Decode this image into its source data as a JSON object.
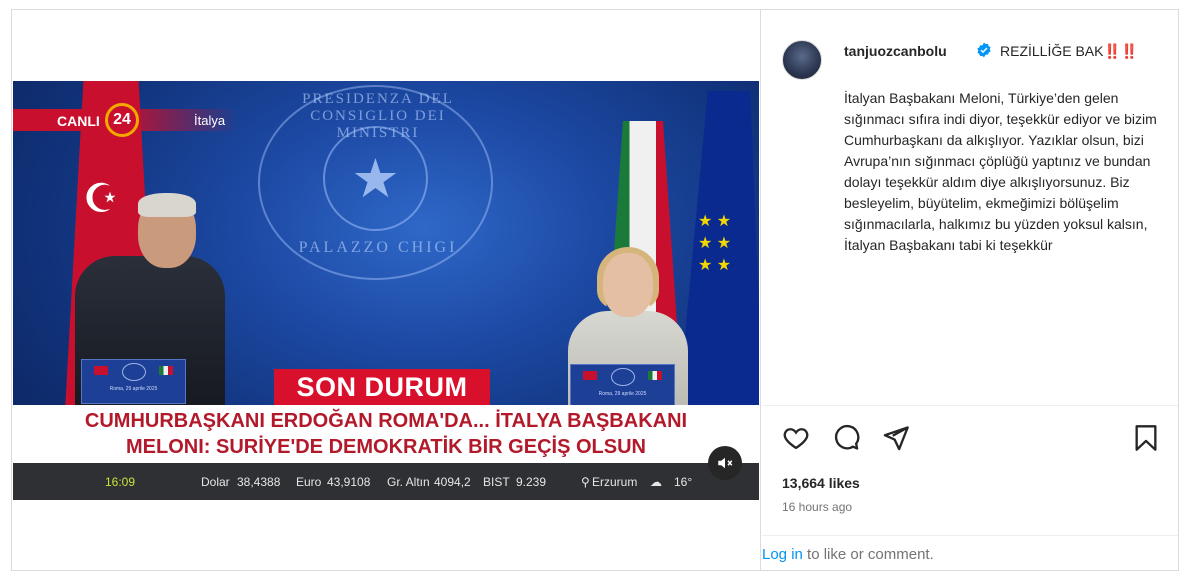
{
  "post": {
    "username": "tanjuozcanbolu",
    "caption_first_line": "REZİLLİĞE BAK‼️‼️",
    "caption_body": "İtalyan Başbakanı Meloni, Türkiye’den gelen sığınmacı sıfıra indi diyor, teşekkür ediyor ve bizim Cumhurbaşkanı da alkışlıyor. Yazıklar olsun, bizi Avrupa’nın sığınmacı çöplüğü yaptınız ve bundan dolayı teşekkür aldım diye alkışlıyorsunuz. Biz besleyelim, büyütelim, ekmeğimizi bölüşelim sığınmacılarla, halkımız bu yüzden yoksul kalsın, İtalyan Başbakanı tabi ki teşekkür",
    "likes": "13,664 likes",
    "time_ago": "16 hours ago",
    "login_link": "Log in",
    "login_suffix": " to like or comment."
  },
  "video": {
    "live_label": "CANLI",
    "channel_number": "24",
    "location_label": "İtalya",
    "seal_top": "PRESIDENZA DEL CONSIGLIO DEI MINISTRI",
    "seal_bottom": "PALAZZO CHIGI",
    "podium_caption": "Roma, 29 aprile 2025",
    "breaking_label": "SON DURUM",
    "headline_line1": "CUMHURBAŞKANI ERDOĞAN ROMA'DA... İTALYA BAŞBAKANI",
    "headline_line2": "MELONI: SURİYE'DE DEMOKRATİK BİR GEÇİŞ OLSUN",
    "ticker": {
      "time": "16:09",
      "dolar_label": "Dolar",
      "dolar_value": "38,4388",
      "euro_label": "Euro",
      "euro_value": "43,9108",
      "gold_label": "Gr. Altın",
      "gold_value": "4094,2",
      "bist_label": "BIST",
      "bist_value": "9.239",
      "city": "Erzurum",
      "temp": "16°"
    }
  },
  "icons": {
    "like": "heart-icon",
    "comment": "comment-icon",
    "share": "share-icon",
    "save": "bookmark-icon",
    "verified": "verified-badge-icon",
    "mute": "muted-speaker-icon"
  },
  "colors": {
    "verified": "#0095f6",
    "link": "#0095f6",
    "breaking_red": "#d8102b",
    "headline_red": "#b21a2b"
  }
}
